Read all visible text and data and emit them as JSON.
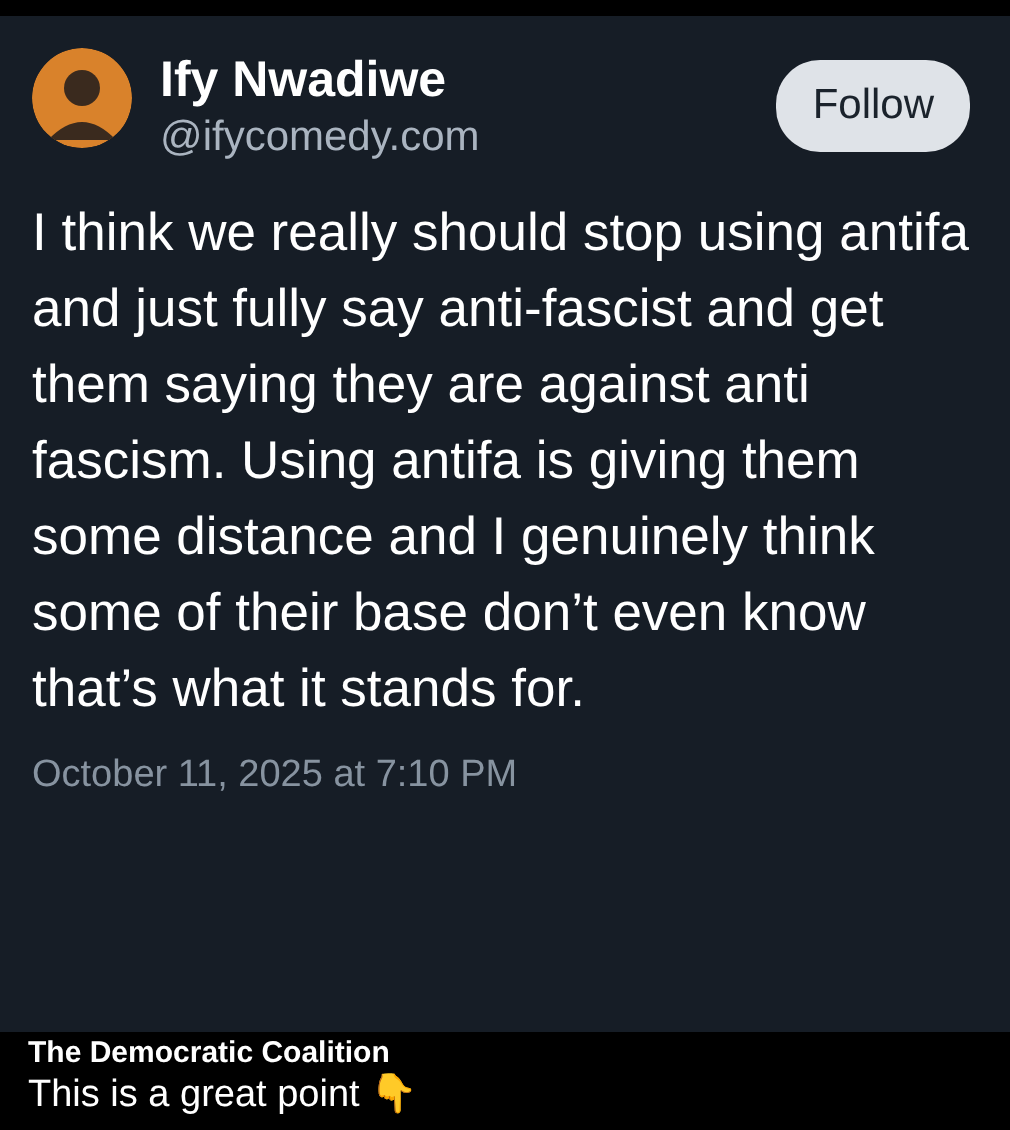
{
  "post": {
    "author_name": "Ify Nwadiwe",
    "handle": "@ifycomedy.com",
    "follow_button": "Follow",
    "body": "I think we really should stop using antifa and just fully say anti-fascist and get them saying they are against anti fascism. Using antifa is giving them some distance and I genuinely think some of their base don’t even know that’s what it stands for.",
    "timestamp": "October 11, 2025 at 7:10 PM"
  },
  "caption": {
    "source": "The Democratic Coalition",
    "text": "This is a great point 👇"
  }
}
